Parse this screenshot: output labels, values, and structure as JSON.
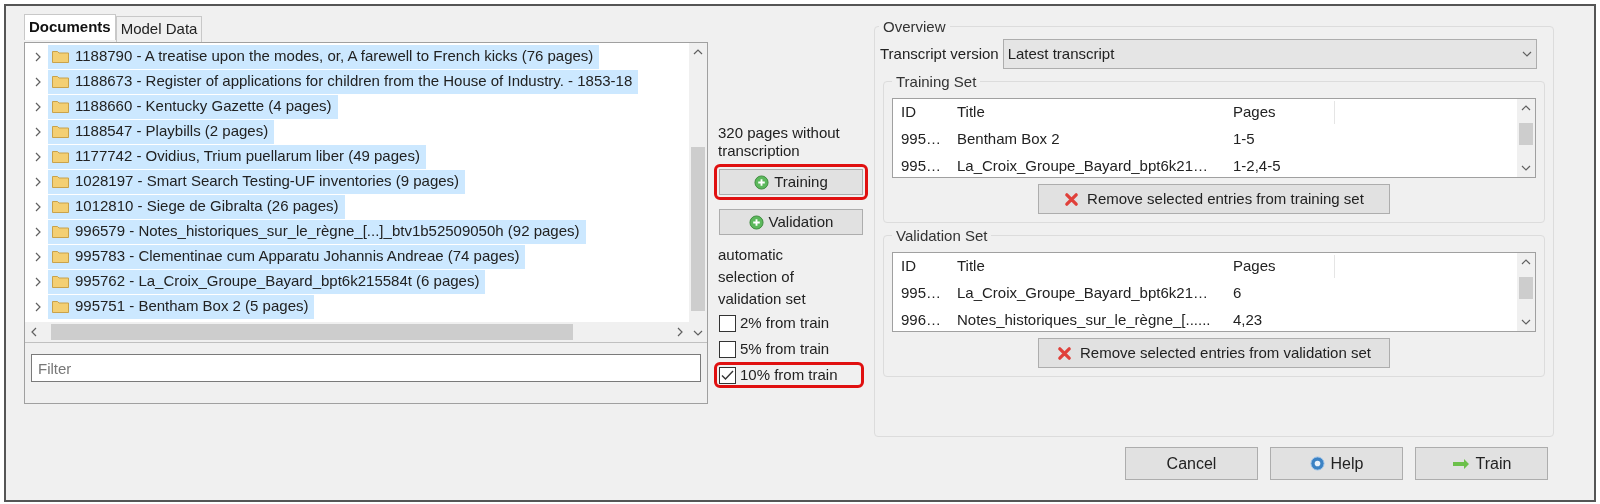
{
  "tabs": [
    {
      "label": "Documents",
      "selected": true
    },
    {
      "label": "Model Data",
      "selected": false
    }
  ],
  "documents": [
    {
      "label": "1188790 - A treatise upon the modes, or, A farewell to French kicks (76 pages)",
      "selected": true
    },
    {
      "label": "1188673 - Register of applications for children from the House of Industry. - 1853-18",
      "selected": true
    },
    {
      "label": "1188660 - Kentucky Gazette (4 pages)",
      "selected": true
    },
    {
      "label": "1188547 - Playbills (2 pages)",
      "selected": true
    },
    {
      "label": "1177742 - Ovidius, Trium puellarum liber (49 pages)",
      "selected": true
    },
    {
      "label": "1028197 - Smart Search Testing-UF inventories (9 pages)",
      "selected": true
    },
    {
      "label": "1012810 - Siege de Gibralta (26 pages)",
      "selected": true
    },
    {
      "label": "996579 - Notes_historiques_sur_le_règne_[...]_btv1b52509050h (92 pages)",
      "selected": true
    },
    {
      "label": "995783 - Clementinae cum Apparatu Johannis Andreae (74 pages)",
      "selected": true
    },
    {
      "label": "995762 - La_Croix_Groupe_Bayard_bpt6k215584t (6 pages)",
      "selected": true
    },
    {
      "label": "995751 - Bentham Box 2 (5 pages)",
      "selected": true
    }
  ],
  "filter": {
    "placeholder": "Filter"
  },
  "pages_info": "320 pages without transcription",
  "add_buttons": [
    {
      "label": "Training",
      "highlighted": true
    },
    {
      "label": "Validation",
      "highlighted": false
    }
  ],
  "auto_selection_label": "automatic selection of validation set",
  "auto_options": [
    {
      "label": "2% from train",
      "checked": false,
      "highlighted": false
    },
    {
      "label": "5% from train",
      "checked": false,
      "highlighted": false
    },
    {
      "label": "10% from train",
      "checked": true,
      "highlighted": true
    }
  ],
  "overview": {
    "title": "Overview",
    "transcript_label": "Transcript version",
    "transcript_value": "Latest transcript"
  },
  "sets": [
    {
      "title": "Training Set",
      "columns": [
        "ID",
        "Title",
        "Pages"
      ],
      "rows": [
        [
          "995…",
          "Bentham Box 2",
          "1-5"
        ],
        [
          "995…",
          "La_Croix_Groupe_Bayard_bpt6k21…",
          "1-2,4-5"
        ]
      ],
      "remove_button": "Remove selected entries from training set"
    },
    {
      "title": "Validation Set",
      "columns": [
        "ID",
        "Title",
        "Pages"
      ],
      "rows": [
        [
          "995…",
          "La_Croix_Groupe_Bayard_bpt6k21…",
          "6"
        ],
        [
          "996…",
          "Notes_historiques_sur_le_règne_[......",
          "4,23"
        ]
      ],
      "remove_button": "Remove selected entries from validation set"
    }
  ],
  "footer_buttons": [
    {
      "label": "Cancel",
      "kind": "plain"
    },
    {
      "label": "Help",
      "kind": "help"
    },
    {
      "label": "Train",
      "kind": "train"
    }
  ]
}
